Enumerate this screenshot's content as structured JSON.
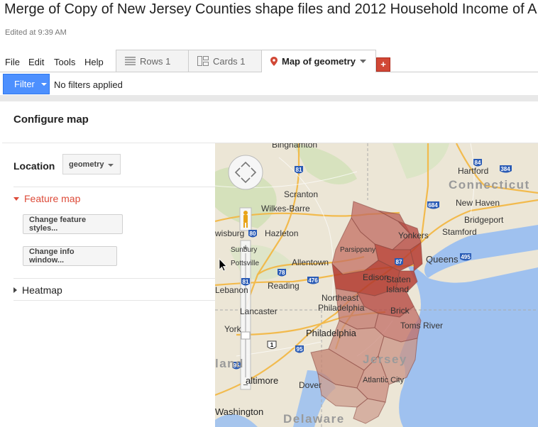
{
  "doc": {
    "title": "Merge of Copy of New Jersey Counties shape files and 2012 Household Income of A",
    "edited": "Edited at 9:39 AM"
  },
  "menu": [
    "File",
    "Edit",
    "Tools",
    "Help"
  ],
  "tabs": {
    "rows": "Rows 1",
    "cards": "Cards 1",
    "map": "Map of geometry",
    "add": "+"
  },
  "filter": {
    "button": "Filter",
    "status": "No filters applied"
  },
  "config": {
    "title": "Configure map",
    "location_label": "Location",
    "location_value": "geometry",
    "feature_map": "Feature map",
    "change_styles": "Change feature styles...",
    "change_info": "Change info window...",
    "heatmap": "Heatmap"
  },
  "map": {
    "zoom_in": "+",
    "zoom_out": "−",
    "colors": {
      "land": "#ece6d6",
      "water": "#9fc1ef",
      "feature_high": "#b83a30",
      "feature_low": "#c8907f"
    },
    "labels": {
      "binghamton": "Binghamton",
      "hartford": "Hartford",
      "connecticut": "Connecticut",
      "scranton": "Scranton",
      "wilkes_barre": "Wilkes-Barre",
      "new_haven": "New Haven",
      "wisburg": "wisburg",
      "hazleton": "Hazleton",
      "yonkers": "Yonkers",
      "bridgeport": "Bridgeport",
      "stamford": "Stamford",
      "sunbury": "Sunbury",
      "parsippany": "Parsippany",
      "allentown": "Allentown",
      "queens": "Queens",
      "pottsville": "Pottsville",
      "edison": "Edison",
      "staten_island_1": "Staten",
      "staten_island_2": "Island",
      "reading": "Reading",
      "lebanon": "Lebanon",
      "northeast": "Northeast",
      "philadelphia_upper": "Philadelphia",
      "lancaster": "Lancaster",
      "brick": "Brick",
      "york": "York",
      "toms_river": "Toms River",
      "philadelphia": "Philadelphia",
      "maryland": "land",
      "new_jersey": "Jersey",
      "baltimore": "altimore",
      "dover": "Dover",
      "atlantic_city": "Atlantic City",
      "washington": "Washington",
      "delaware": "Delaware"
    },
    "shields": [
      "81",
      "84",
      "384",
      "684",
      "80",
      "87",
      "78",
      "476",
      "81",
      "495",
      "95",
      "1",
      "95"
    ]
  }
}
